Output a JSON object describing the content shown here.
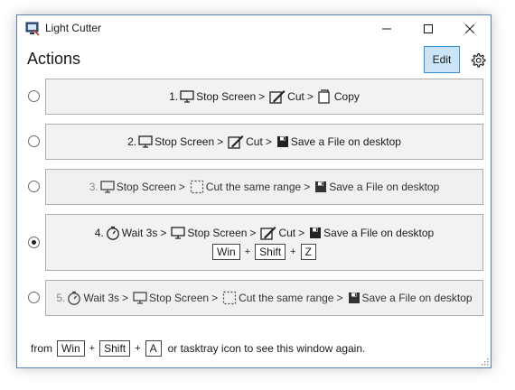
{
  "window": {
    "title": "Light Cutter"
  },
  "header": {
    "title": "Actions",
    "edit_label": "Edit"
  },
  "actions": [
    {
      "number": "1.",
      "selected": false,
      "steps": [
        "Stop Screen",
        "Cut",
        "Copy"
      ],
      "separator": ">"
    },
    {
      "number": "2.",
      "selected": false,
      "steps": [
        "Stop Screen",
        "Cut",
        "Save a File on desktop"
      ],
      "separator": ">"
    },
    {
      "number": "3.",
      "selected": false,
      "steps": [
        "Stop Screen",
        "Cut the same range",
        "Save a File on desktop"
      ],
      "separator": ">"
    },
    {
      "number": "4.",
      "selected": true,
      "steps": [
        "Wait 3s",
        "Stop Screen",
        "Cut",
        "Save a File on desktop"
      ],
      "separator": ">",
      "shortcut": [
        "Win",
        "Shift",
        "Z"
      ]
    },
    {
      "number": "5.",
      "selected": false,
      "steps": [
        "Wait 3s",
        "Stop Screen",
        "Cut the same range",
        "Save a File on desktop"
      ],
      "separator": ">"
    }
  ],
  "footer": {
    "prefix": "from",
    "keys": [
      "Win",
      "Shift",
      "A"
    ],
    "plus": "+",
    "suffix": "or tasktray icon to see this window again."
  },
  "icons": {
    "app": "scissors-screen-icon",
    "monitor": "monitor-icon",
    "cut": "pen-cut-icon",
    "dashed": "dashed-rect-icon",
    "copy": "copy-icon",
    "save": "floppy-disk-icon",
    "timer": "stopwatch-icon",
    "settings": "gear-icon"
  },
  "colors": {
    "edit_bg": "#cce4f7",
    "edit_border": "#2f8fd8",
    "window_border": "#5a7fb0"
  }
}
